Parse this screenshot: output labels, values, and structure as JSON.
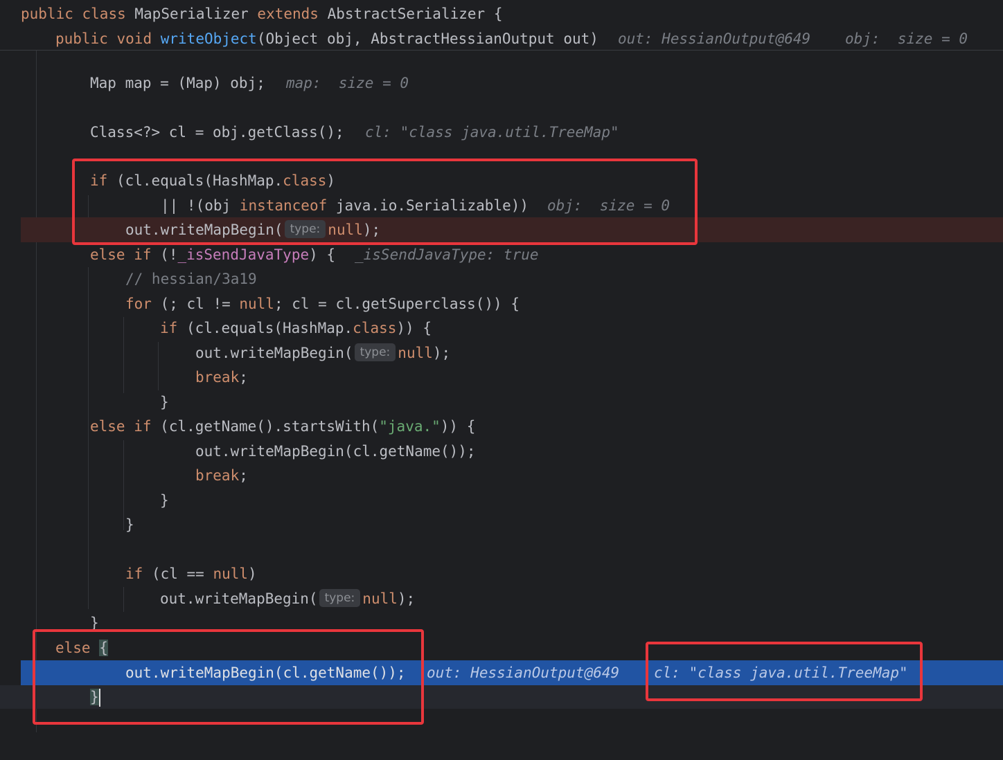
{
  "header": {
    "line1": {
      "kw1": "public",
      "kw2": "class",
      "name": "MapSerializer",
      "kw3": "extends",
      "parent": "AbstractSerializer",
      "brace": "{"
    },
    "line2": {
      "kw1": "public",
      "kw2": "void",
      "method": "writeObject",
      "params": "(Object obj, AbstractHessianOutput out)",
      "hint1": "out: HessianOutput@649",
      "hint2": "obj:  size = 0"
    }
  },
  "code": {
    "l1": {
      "text": "Map map = (Map) obj;",
      "hint": "map:  size = 0"
    },
    "l2": {
      "text": "Class<?> cl = obj.getClass();",
      "hint": "cl: \"class java.util.TreeMap\""
    },
    "l3": {
      "kw": "if",
      "a": " (cl.equals(HashMap.",
      "cls": "class",
      ")": ")"
    },
    "l4": {
      "a": "|| !(obj ",
      "kw": "instanceof",
      "b": " java.io.Serializable))",
      "hint": "obj:  size = 0"
    },
    "l5": {
      "a": "out.writeMapBegin(",
      "badge": "type:",
      "nul": "null",
      "b": ");"
    },
    "l6": {
      "kw1": "else",
      "kw2": "if",
      "a": " (!",
      "fld": "_isSendJavaType",
      "b": ") {",
      "hint": "_isSendJavaType: true"
    },
    "l7": {
      "text": "// hessian/3a19"
    },
    "l8": {
      "kw": "for",
      "a": " (; cl != ",
      "nul": "null",
      "b": "; cl = cl.getSuperclass()) {"
    },
    "l9": {
      "kw": "if",
      "a": " (cl.equals(HashMap.",
      "cls": "class",
      "b": ")) {"
    },
    "l10": {
      "a": "out.writeMapBegin(",
      "badge": "type:",
      "nul": "null",
      "b": ");"
    },
    "l11": {
      "kw": "break",
      "b": ";"
    },
    "l12": {
      "text": "}"
    },
    "l13": {
      "kw1": "else",
      "kw2": "if",
      "a": " (cl.getName().startsWith(",
      "str": "\"java.\"",
      "b": ")) {"
    },
    "l14": {
      "text": "out.writeMapBegin(cl.getName());"
    },
    "l15": {
      "kw": "break",
      "b": ";"
    },
    "l16": {
      "text": "}"
    },
    "l17": {
      "text": "}"
    },
    "l18": {
      "kw": "if",
      "a": " (cl == ",
      "nul": "null",
      "b": ")"
    },
    "l19": {
      "a": "out.writeMapBegin(",
      "badge": "type:",
      "nul": "null",
      "b": ");"
    },
    "l20": {
      "text": "}"
    },
    "l21": {
      "kw": "else",
      "b": "{"
    },
    "l22": {
      "text": "out.writeMapBegin(cl.getName());",
      "hint1": "out: HessianOutput@649",
      "hint2": "cl: \"class java.util.TreeMap\""
    },
    "l23": {
      "text": "}"
    }
  },
  "colors": {
    "background": "#1e1f22",
    "keyword": "#cf8e6d",
    "method": "#56a8f5",
    "field": "#c77dbb",
    "string": "#6aab73",
    "hint": "#7a7e85",
    "breakpoint_line": "#3a2323",
    "execution_line": "#2154a3",
    "annotation_box": "#e8363c"
  }
}
